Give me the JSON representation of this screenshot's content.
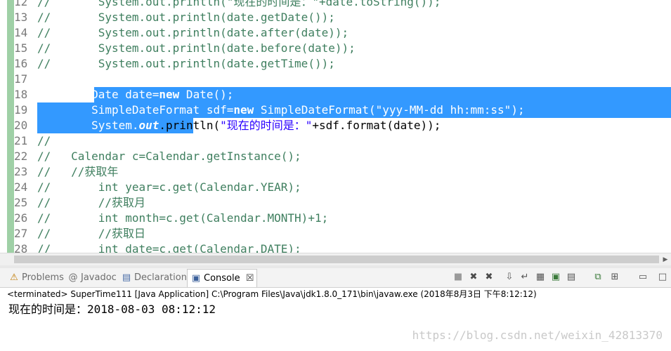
{
  "editor": {
    "lines": [
      {
        "num": "12",
        "parts": [
          {
            "c": "cm",
            "t": "//       System.out.println(\"现在的时间是：\"+date.toString());"
          }
        ]
      },
      {
        "num": "13",
        "parts": [
          {
            "c": "cm",
            "t": "//       System.out.println(date.getDate());"
          }
        ]
      },
      {
        "num": "14",
        "parts": [
          {
            "c": "cm",
            "t": "//       System.out.println(date.after(date));"
          }
        ]
      },
      {
        "num": "15",
        "parts": [
          {
            "c": "cm",
            "t": "//       System.out.println(date.before(date));"
          }
        ]
      },
      {
        "num": "16",
        "parts": [
          {
            "c": "cm",
            "t": "//       System.out.println(date.getTime());"
          }
        ]
      },
      {
        "num": "17",
        "parts": []
      },
      {
        "num": "18",
        "parts": [
          {
            "c": "",
            "t": "        Date date="
          },
          {
            "c": "kw",
            "t": "new"
          },
          {
            "c": "",
            "t": " Date();"
          }
        ]
      },
      {
        "num": "19",
        "parts": [
          {
            "c": "",
            "t": "        SimpleDateFormat sdf="
          },
          {
            "c": "kw",
            "t": "new"
          },
          {
            "c": "",
            "t": " SimpleDateFormat("
          },
          {
            "c": "str",
            "t": "\"yyy-MM-dd hh:mm:ss\""
          },
          {
            "c": "",
            "t": ");"
          }
        ]
      },
      {
        "num": "20",
        "parts": [
          {
            "c": "",
            "t": "        System."
          },
          {
            "c": "fld",
            "t": "out"
          },
          {
            "c": "",
            "t": ".println("
          },
          {
            "c": "str",
            "t": "\"现在的时间是：\""
          },
          {
            "c": "",
            "t": "+sdf.format(date));"
          }
        ]
      },
      {
        "num": "21",
        "parts": [
          {
            "c": "cm",
            "t": "//"
          }
        ]
      },
      {
        "num": "22",
        "parts": [
          {
            "c": "cm",
            "t": "//   Calendar c=Calendar.getInstance();"
          }
        ]
      },
      {
        "num": "23",
        "parts": [
          {
            "c": "cm",
            "t": "//   //获取年"
          }
        ]
      },
      {
        "num": "24",
        "parts": [
          {
            "c": "cm",
            "t": "//       int year=c.get(Calendar.YEAR);"
          }
        ]
      },
      {
        "num": "25",
        "parts": [
          {
            "c": "cm",
            "t": "//       //获取月"
          }
        ]
      },
      {
        "num": "26",
        "parts": [
          {
            "c": "cm",
            "t": "//       int month=c.get(Calendar.MONTH)+1;"
          }
        ]
      },
      {
        "num": "27",
        "parts": [
          {
            "c": "cm",
            "t": "//       //获取日"
          }
        ]
      },
      {
        "num": "28",
        "parts": [
          {
            "c": "cm",
            "t": "//       int date=c.get(Calendar.DATE);"
          }
        ]
      }
    ]
  },
  "tabs": {
    "problems": "Problems",
    "javadoc": "Javadoc",
    "declaration": "Declaration",
    "console": "Console",
    "console_close": "☒"
  },
  "toolbar_icons": [
    "terminate-icon",
    "remove-launch-icon",
    "remove-all-icon",
    "scroll-lock-icon",
    "word-wrap-icon",
    "pin-icon",
    "show-console-icon",
    "open-console-icon",
    "display-selected-icon",
    "new-console-icon",
    "minimize-icon",
    "maximize-icon"
  ],
  "console": {
    "status": "<terminated> SuperTime111 [Java Application] C:\\Program Files\\Java\\jdk1.8.0_171\\bin\\javaw.exe (2018年8月3日 下午8:12:12)",
    "output": "现在的时间是：2018-08-03 08:12:12"
  },
  "watermark": "https://blog.csdn.net/weixin_42813370"
}
